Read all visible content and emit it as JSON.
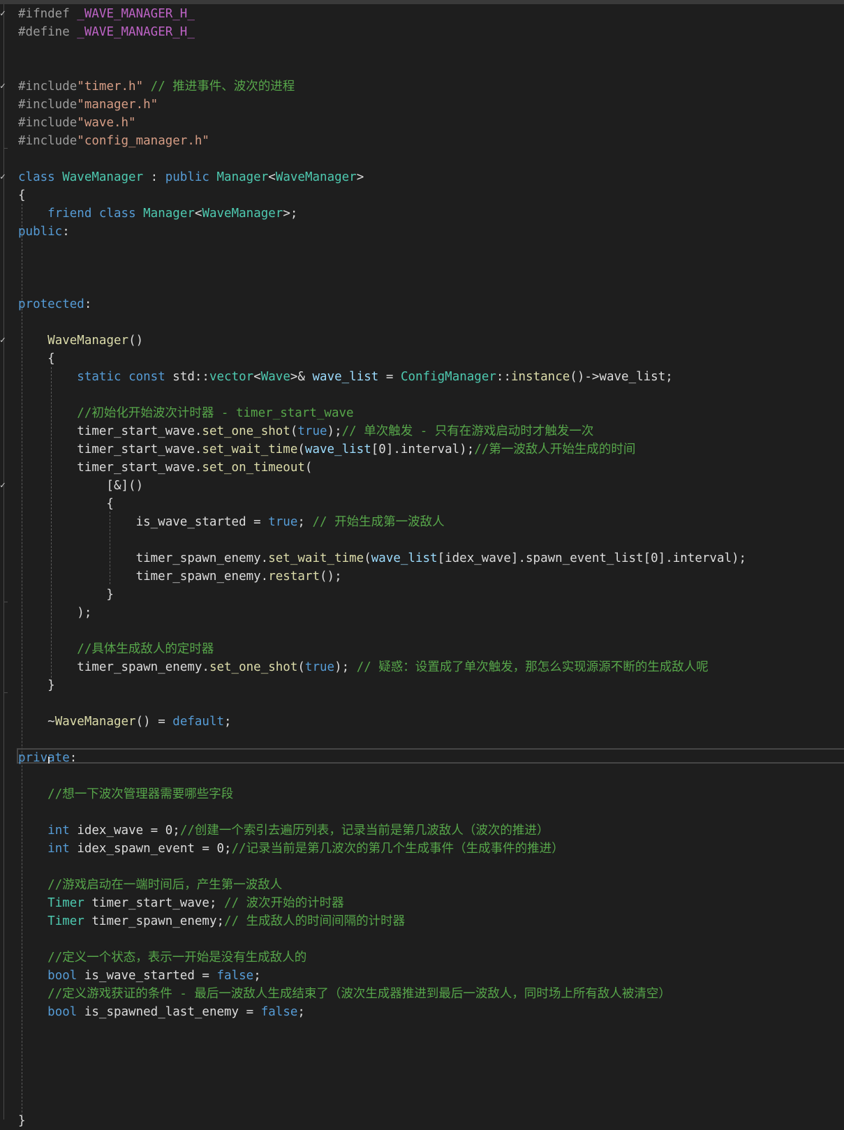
{
  "editor": {
    "colors": {
      "background": "#1e1e1e",
      "text": "#dcdcdc",
      "keyword": "#569cd6",
      "type": "#4ec9b0",
      "string": "#d69d85",
      "comment": "#57a64a",
      "preprocessor": "#9b9b9b",
      "macro": "#bd63c5",
      "function": "#dcdcaa",
      "variable": "#9cdcfe"
    },
    "lines": [
      {
        "mark": "check",
        "tokens": [
          [
            "#ifndef ",
            "p"
          ],
          [
            "_WAVE_MANAGER_H_",
            "m"
          ]
        ]
      },
      {
        "tokens": [
          [
            "#define ",
            "p"
          ],
          [
            "_WAVE_MANAGER_H_",
            "m"
          ]
        ]
      },
      {
        "tokens": []
      },
      {
        "tokens": []
      },
      {
        "mark": "check",
        "tokens": [
          [
            "#include",
            "p"
          ],
          [
            "\"timer.h\"",
            "s"
          ],
          [
            " // 推进事件、波次的进程",
            "c"
          ]
        ]
      },
      {
        "tokens": [
          [
            "#include",
            "p"
          ],
          [
            "\"manager.h\"",
            "s"
          ]
        ]
      },
      {
        "tokens": [
          [
            "#include",
            "p"
          ],
          [
            "\"wave.h\"",
            "s"
          ]
        ]
      },
      {
        "tokens": [
          [
            "#include",
            "p"
          ],
          [
            "\"config_manager.h\"",
            "s"
          ]
        ]
      },
      {
        "tokens": []
      },
      {
        "mark": "check",
        "tokens": [
          [
            "class ",
            "k"
          ],
          [
            "WaveManager",
            "t"
          ],
          [
            " : ",
            "o"
          ],
          [
            "public ",
            "k"
          ],
          [
            "Manager",
            "t"
          ],
          [
            "<",
            "o"
          ],
          [
            "WaveManager",
            "t"
          ],
          [
            ">",
            "o"
          ]
        ]
      },
      {
        "tokens": [
          [
            "{",
            "o"
          ]
        ]
      },
      {
        "tokens": [
          [
            "    ",
            "o"
          ],
          [
            "friend ",
            "k"
          ],
          [
            "class ",
            "k"
          ],
          [
            "Manager",
            "t"
          ],
          [
            "<",
            "o"
          ],
          [
            "WaveManager",
            "t"
          ],
          [
            ">;",
            "o"
          ]
        ]
      },
      {
        "tokens": [
          [
            "public",
            "k"
          ],
          [
            ":",
            "o"
          ]
        ]
      },
      {
        "tokens": []
      },
      {
        "tokens": []
      },
      {
        "tokens": []
      },
      {
        "tokens": [
          [
            "protected",
            "k"
          ],
          [
            ":",
            "o"
          ]
        ]
      },
      {
        "tokens": []
      },
      {
        "mark": "check",
        "tokens": [
          [
            "    ",
            "o"
          ],
          [
            "WaveManager",
            "f"
          ],
          [
            "()",
            "o"
          ]
        ]
      },
      {
        "tokens": [
          [
            "    {",
            "o"
          ]
        ]
      },
      {
        "tokens": [
          [
            "        ",
            "o"
          ],
          [
            "static ",
            "k"
          ],
          [
            "const ",
            "k"
          ],
          [
            "std",
            "o"
          ],
          [
            "::",
            "o"
          ],
          [
            "vector",
            "t"
          ],
          [
            "<",
            "o"
          ],
          [
            "Wave",
            "t"
          ],
          [
            ">& ",
            "o"
          ],
          [
            "wave_list",
            "v"
          ],
          [
            " = ",
            "o"
          ],
          [
            "ConfigManager",
            "t"
          ],
          [
            "::",
            "o"
          ],
          [
            "instance",
            "f"
          ],
          [
            "()->wave_list;",
            "o"
          ]
        ]
      },
      {
        "tokens": []
      },
      {
        "tokens": [
          [
            "        ",
            "o"
          ],
          [
            "//初始化开始波次计时器 - timer_start_wave",
            "c"
          ]
        ]
      },
      {
        "tokens": [
          [
            "        timer_start_wave.",
            "o"
          ],
          [
            "set_one_shot",
            "f"
          ],
          [
            "(",
            "o"
          ],
          [
            "true",
            "k"
          ],
          [
            ");",
            "o"
          ],
          [
            "// 单次触发 - 只有在游戏启动时才触发一次",
            "c"
          ]
        ]
      },
      {
        "tokens": [
          [
            "        timer_start_wave.",
            "o"
          ],
          [
            "set_wait_time",
            "f"
          ],
          [
            "(",
            "o"
          ],
          [
            "wave_list",
            "v"
          ],
          [
            "[0].interval);",
            "o"
          ],
          [
            "//第一波敌人开始生成的时间",
            "c"
          ]
        ]
      },
      {
        "tokens": [
          [
            "        timer_start_wave.",
            "o"
          ],
          [
            "set_on_timeout",
            "f"
          ],
          [
            "(",
            "o"
          ]
        ]
      },
      {
        "mark": "check",
        "tokens": [
          [
            "            [&]()",
            "o"
          ]
        ]
      },
      {
        "tokens": [
          [
            "            {",
            "o"
          ]
        ]
      },
      {
        "tokens": [
          [
            "                is_wave_started = ",
            "o"
          ],
          [
            "true",
            "k"
          ],
          [
            "; ",
            "o"
          ],
          [
            "// 开始生成第一波敌人",
            "c"
          ]
        ]
      },
      {
        "tokens": []
      },
      {
        "tokens": [
          [
            "                timer_spawn_enemy.",
            "o"
          ],
          [
            "set_wait_time",
            "f"
          ],
          [
            "(",
            "o"
          ],
          [
            "wave_list",
            "v"
          ],
          [
            "[idex_wave].spawn_event_list[0].interval);",
            "o"
          ]
        ]
      },
      {
        "tokens": [
          [
            "                timer_spawn_enemy.",
            "o"
          ],
          [
            "restart",
            "f"
          ],
          [
            "();",
            "o"
          ]
        ]
      },
      {
        "tokens": [
          [
            "            }",
            "o"
          ]
        ]
      },
      {
        "tokens": [
          [
            "        );",
            "o"
          ]
        ]
      },
      {
        "tokens": []
      },
      {
        "tokens": [
          [
            "        ",
            "o"
          ],
          [
            "//具体生成敌人的定时器",
            "c"
          ]
        ]
      },
      {
        "tokens": [
          [
            "        timer_spawn_enemy.",
            "o"
          ],
          [
            "set_one_shot",
            "f"
          ],
          [
            "(",
            "o"
          ],
          [
            "true",
            "k"
          ],
          [
            "); ",
            "o"
          ],
          [
            "// 疑惑：设置成了单次触发，那怎么实现源源不断的生成敌人呢",
            "c"
          ]
        ]
      },
      {
        "tokens": [
          [
            "    }",
            "o"
          ]
        ]
      },
      {
        "tokens": []
      },
      {
        "tokens": [
          [
            "    ~",
            "o"
          ],
          [
            "WaveManager",
            "f"
          ],
          [
            "() = ",
            "o"
          ],
          [
            "default",
            "k"
          ],
          [
            ";",
            "o"
          ]
        ]
      },
      {
        "tokens": []
      },
      {
        "tokens": [
          [
            "private",
            "k"
          ],
          [
            ":",
            "o"
          ]
        ]
      },
      {
        "tokens": []
      },
      {
        "tokens": [
          [
            "    ",
            "o"
          ],
          [
            "//想一下波次管理器需要哪些字段",
            "c"
          ]
        ]
      },
      {
        "tokens": []
      },
      {
        "tokens": [
          [
            "    ",
            "o"
          ],
          [
            "int ",
            "k"
          ],
          [
            "idex_wave = 0;",
            "o"
          ],
          [
            "//创建一个索引去遍历列表，记录当前是第几波敌人（波次的推进）",
            "c"
          ]
        ]
      },
      {
        "tokens": [
          [
            "    ",
            "o"
          ],
          [
            "int ",
            "k"
          ],
          [
            "idex_spawn_event = 0;",
            "o"
          ],
          [
            "//记录当前是第几波次的第几个生成事件（生成事件的推进）",
            "c"
          ]
        ]
      },
      {
        "tokens": []
      },
      {
        "tokens": [
          [
            "    ",
            "o"
          ],
          [
            "//游戏启动在一端时间后，产生第一波敌人",
            "c"
          ]
        ]
      },
      {
        "tokens": [
          [
            "    ",
            "o"
          ],
          [
            "Timer ",
            "t"
          ],
          [
            "timer_start_wave; ",
            "o"
          ],
          [
            "// 波次开始的计时器",
            "c"
          ]
        ]
      },
      {
        "tokens": [
          [
            "    ",
            "o"
          ],
          [
            "Timer ",
            "t"
          ],
          [
            "timer_spawn_enemy;",
            "o"
          ],
          [
            "// 生成敌人的时间间隔的计时器",
            "c"
          ]
        ]
      },
      {
        "tokens": []
      },
      {
        "tokens": [
          [
            "    ",
            "o"
          ],
          [
            "//定义一个状态，表示一开始是没有生成敌人的",
            "c"
          ]
        ]
      },
      {
        "tokens": [
          [
            "    ",
            "o"
          ],
          [
            "bool ",
            "k"
          ],
          [
            "is_wave_started = ",
            "o"
          ],
          [
            "false",
            "k"
          ],
          [
            ";",
            "o"
          ]
        ]
      },
      {
        "tokens": [
          [
            "    ",
            "o"
          ],
          [
            "//定义游戏获证的条件 - 最后一波敌人生成结束了（波次生成器推进到最后一波敌人，同时场上所有敌人被清空）",
            "c"
          ]
        ]
      },
      {
        "tokens": [
          [
            "    ",
            "o"
          ],
          [
            "bool ",
            "k"
          ],
          [
            "is_spawned_last_enemy = ",
            "o"
          ],
          [
            "false",
            "k"
          ],
          [
            ";",
            "o"
          ]
        ]
      },
      {
        "tokens": []
      },
      {
        "tokens": []
      },
      {
        "tokens": []
      },
      {
        "tokens": []
      },
      {
        "tokens": []
      },
      {
        "tokens": [
          [
            "}",
            "o"
          ]
        ]
      }
    ]
  }
}
